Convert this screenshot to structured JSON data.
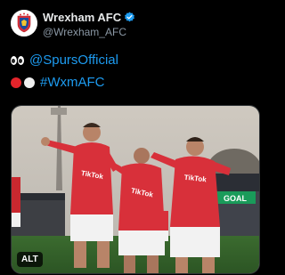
{
  "account": {
    "display_name": "Wrexham AFC",
    "handle": "@Wrexham_AFC"
  },
  "tweet": {
    "line1_link": "@SpursOfficial",
    "line2_link": "#WxmAFC"
  },
  "media": {
    "alt_label": "ALT",
    "board_text": "GOAL",
    "sponsor_text": "TikTok"
  },
  "colors": {
    "link": "#1d9bf0",
    "verified": "#1d9bf0",
    "kit_red": "#d8303a",
    "background": "#000000"
  },
  "icons": [
    "wrexham-crest-icon",
    "verified-badge-icon",
    "eyes-emoji-icon",
    "red-circle-emoji-icon",
    "white-circle-emoji-icon"
  ]
}
